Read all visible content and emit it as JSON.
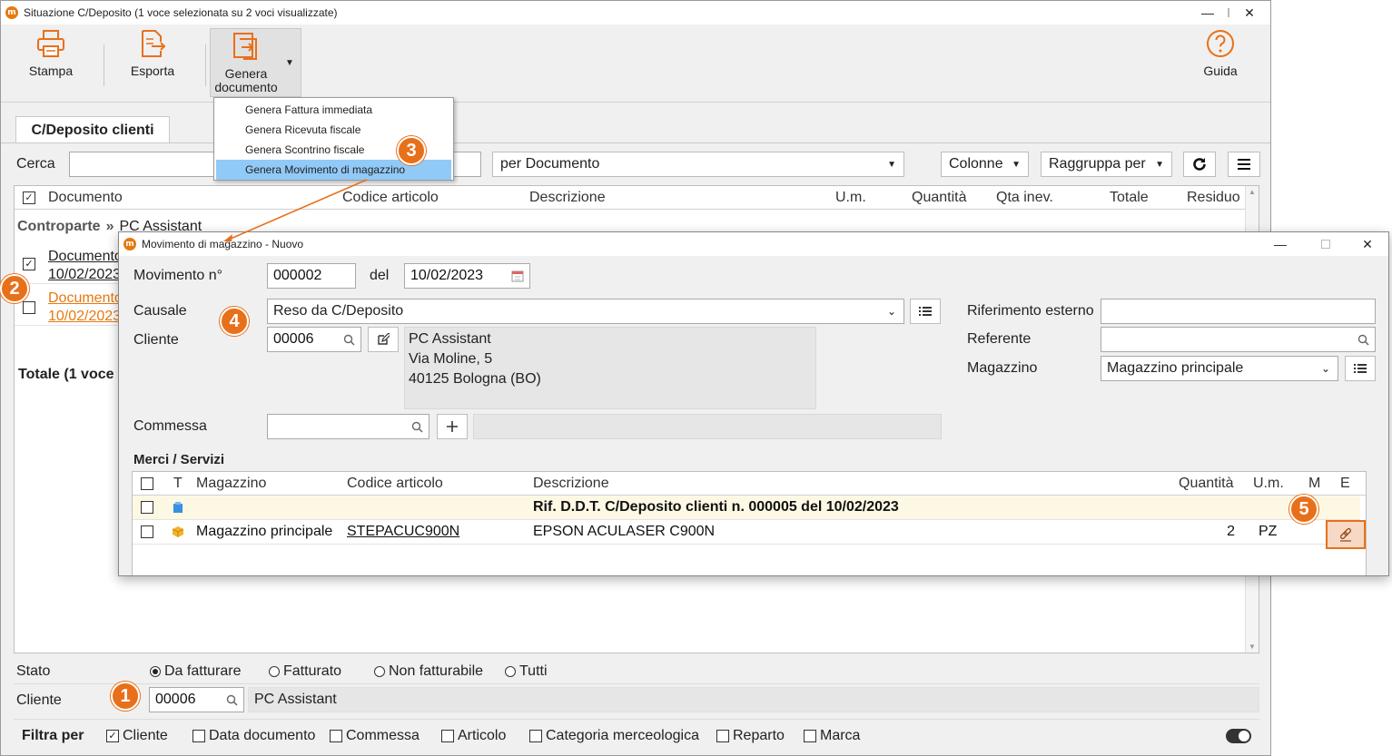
{
  "main_window": {
    "title": "Situazione C/Deposito (1 voce selezionata su 2 voci visualizzate)",
    "toolbar": {
      "print_label": "Stampa",
      "export_label": "Esporta",
      "generate_label_1": "Genera",
      "generate_label_2": "documento",
      "help_label": "Guida"
    },
    "tab_label": "C/Deposito clienti",
    "search_label": "Cerca",
    "search_by_value": "per Documento",
    "columns_label": "Colonne",
    "group_by_label": "Raggruppa per",
    "grid": {
      "headers": [
        "Documento",
        "Codice articolo",
        "Descrizione",
        "U.m.",
        "Quantità",
        "Qta inev.",
        "Totale",
        "Residuo"
      ],
      "group_label": "Controparte",
      "group_separator": "»",
      "group_value": "PC Assistant",
      "rows": [
        {
          "doc": "Documento",
          "date": "10/02/2023",
          "checked": true
        },
        {
          "doc": "Documento",
          "date": "10/02/2023",
          "checked": false
        }
      ],
      "total_label": "Totale (1 voce"
    },
    "status": {
      "label": "Stato",
      "options": [
        "Da fatturare",
        "Fatturato",
        "Non fatturabile",
        "Tutti"
      ],
      "selected": "Da fatturare"
    },
    "customer": {
      "label": "Cliente",
      "code": "00006",
      "name": "PC Assistant"
    },
    "filter": {
      "label": "Filtra per",
      "options": [
        {
          "label": "Cliente",
          "checked": true
        },
        {
          "label": "Data documento",
          "checked": false
        },
        {
          "label": "Commessa",
          "checked": false
        },
        {
          "label": "Articolo",
          "checked": false
        },
        {
          "label": "Categoria merceologica",
          "checked": false
        },
        {
          "label": "Reparto",
          "checked": false
        },
        {
          "label": "Marca",
          "checked": false
        }
      ]
    }
  },
  "dropdown_menu": {
    "items": [
      "Genera Fattura immediata",
      "Genera Ricevuta fiscale",
      "Genera Scontrino fiscale",
      "Genera Movimento di magazzino"
    ],
    "selected_index": 3
  },
  "dialog": {
    "title": "Movimento di magazzino - Nuovo",
    "movement_label": "Movimento n°",
    "movement_number": "000002",
    "date_label": "del",
    "date_value": "10/02/2023",
    "reason_label": "Causale",
    "reason_value": "Reso da C/Deposito",
    "customer_label": "Cliente",
    "customer_code": "00006",
    "address_lines": [
      "PC Assistant",
      "Via Moline, 5",
      "40125 Bologna (BO)"
    ],
    "external_ref_label": "Riferimento esterno",
    "external_ref_value": "",
    "contact_label": "Referente",
    "contact_value": "",
    "warehouse_label": "Magazzino",
    "warehouse_value": "Magazzino principale",
    "job_label": "Commessa",
    "job_value": "",
    "section_title": "Merci / Servizi",
    "grid": {
      "headers": [
        "T",
        "Magazzino",
        "Codice articolo",
        "Descrizione",
        "Quantità",
        "U.m.",
        "M",
        "E"
      ],
      "rows": [
        {
          "warehouse": "",
          "code": "",
          "description": "Rif. D.D.T. C/Deposito clienti n. 000005 del 10/02/2023",
          "qty": "",
          "um": "",
          "type_icon": "note-icon"
        },
        {
          "warehouse": "Magazzino principale",
          "code": "STEPACUC900N",
          "description": "EPSON ACULASER C900N",
          "qty": "2",
          "um": "PZ",
          "type_icon": "box-icon"
        }
      ]
    }
  },
  "step_badges": [
    "1",
    "2",
    "3",
    "4",
    "5"
  ],
  "colors": {
    "accent": "#e8701a",
    "menu_highlight": "#91c9f7",
    "link_orange": "#e8790f"
  }
}
